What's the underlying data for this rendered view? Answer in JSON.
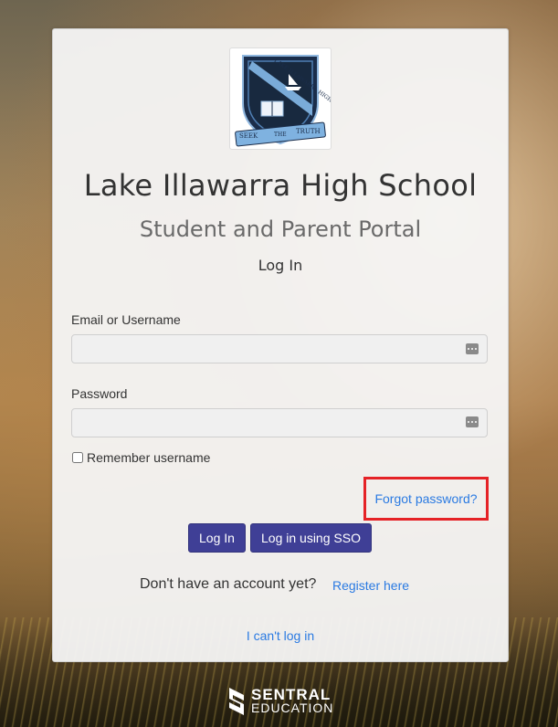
{
  "school": {
    "name": "Lake Illawarra High School",
    "portal": "Student and Parent Portal",
    "crest_text": "LAKE ILLAWARRA HIGH SCHOOL",
    "motto": [
      "SEEK",
      "THE",
      "TRUTH"
    ]
  },
  "form": {
    "title": "Log In",
    "email_label": "Email or Username",
    "email_value": "",
    "password_label": "Password",
    "password_value": "",
    "remember_label": "Remember username",
    "remember_checked": false,
    "forgot_link": "Forgot password?",
    "login_button": "Log In",
    "sso_button": "Log in using SSO",
    "no_account_text": "Don't have an account yet?",
    "register_link": "Register here",
    "cant_login_link": "I can't log in"
  },
  "footer": {
    "brand_line1": "SENTRAL",
    "brand_line2": "EDUCATION"
  },
  "colors": {
    "button": "#3f3f96",
    "link": "#2a7ae2",
    "highlight": "#e52226"
  },
  "icons": [
    "crest-logo",
    "password-manager-icon",
    "sentral-logo-icon"
  ]
}
